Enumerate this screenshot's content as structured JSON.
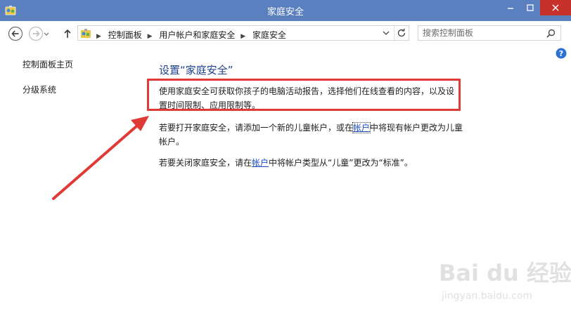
{
  "window": {
    "title": "家庭安全",
    "icons": [
      "control-panel-icon",
      "minimize-icon",
      "maximize-icon",
      "close-icon"
    ]
  },
  "colors": {
    "titlebar": "#5a80c0",
    "close_button": "#c7312b",
    "heading": "#1e3f8f",
    "link": "#1a4fbf",
    "highlight": "#e03a36"
  },
  "navbar": {
    "breadcrumbs": [
      "控制面板",
      "用户帐户和家庭安全",
      "家庭安全"
    ],
    "search_placeholder": "搜索控制面板",
    "icons": [
      "back-arrow-icon",
      "forward-arrow-icon",
      "up-arrow-icon",
      "refresh-icon",
      "search-icon",
      "help-icon"
    ]
  },
  "sidebar": {
    "items": [
      {
        "label": "控制面板主页"
      },
      {
        "label": "分级系统"
      }
    ]
  },
  "main": {
    "title": "设置“家庭安全”",
    "paragraph1": "使用家庭安全可获取你孩子的电脑活动报告，选择他们在线查看的内容，以及设置时间限制、应用限制等。",
    "paragraph2": {
      "before": "若要打开家庭安全，请添加一个新的儿童帐户，或在",
      "link": "帐户",
      "after": "中将现有帐户更改为儿童帐户。"
    },
    "paragraph3": {
      "before": "若要关闭家庭安全，请在",
      "link": "帐户",
      "after": "中将帐户类型从“儿童”更改为“标准”。"
    }
  },
  "watermark": {
    "main": "Bai du 经验",
    "sub": "jingyan.baidu.com"
  }
}
